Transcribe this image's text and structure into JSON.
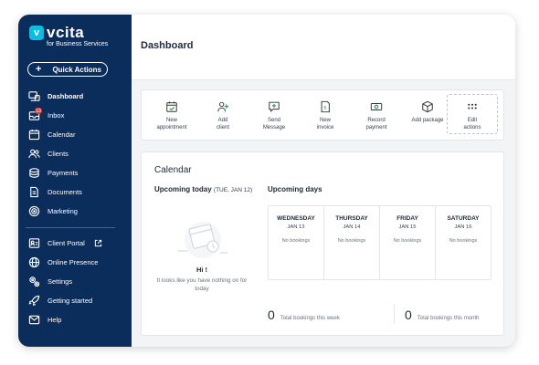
{
  "logo": {
    "mark": "v",
    "name": "vcita",
    "tagline": "for Business Services"
  },
  "quick_actions": {
    "label": "Quick Actions",
    "icon": "plus-icon"
  },
  "sidebar": {
    "items": [
      {
        "label": "Dashboard",
        "icon": "dashboard-icon",
        "active": true
      },
      {
        "label": "Inbox",
        "icon": "inbox-icon",
        "badge": "13"
      },
      {
        "label": "Calendar",
        "icon": "calendar-icon"
      },
      {
        "label": "Clients",
        "icon": "clients-icon"
      },
      {
        "label": "Payments",
        "icon": "payments-icon"
      },
      {
        "label": "Documents",
        "icon": "documents-icon"
      },
      {
        "label": "Marketing",
        "icon": "marketing-icon"
      }
    ],
    "bottom_items": [
      {
        "label": "Client Portal",
        "icon": "client-portal-icon",
        "external": true
      },
      {
        "label": "Online Presence",
        "icon": "globe-icon"
      },
      {
        "label": "Settings",
        "icon": "settings-icon"
      },
      {
        "label": "Getting started",
        "icon": "rocket-icon"
      },
      {
        "label": "Help",
        "icon": "help-icon"
      }
    ]
  },
  "header": {
    "title": "Dashboard"
  },
  "quick_action_bar": [
    {
      "label": "New\nappointment",
      "icon": "new-appointment-icon"
    },
    {
      "label": "Add\nclient",
      "icon": "add-client-icon"
    },
    {
      "label": "Send\nMessage",
      "icon": "send-message-icon"
    },
    {
      "label": "New\ninvoice",
      "icon": "new-invoice-icon"
    },
    {
      "label": "Record\npayment",
      "icon": "record-payment-icon"
    },
    {
      "label": "Add package",
      "icon": "add-package-icon"
    },
    {
      "label": "Edit\nactions",
      "icon": "edit-actions-icon"
    }
  ],
  "calendar": {
    "title": "Calendar",
    "today_label": "Upcoming today",
    "today_date": "(TUE, JAN 12)",
    "empty_title": "Hi !",
    "empty_text": "It looks like you have nothing on for today",
    "upcoming_label": "Upcoming days",
    "days": [
      {
        "name": "WEDNESDAY",
        "date": "JAN 13",
        "status": "No bookings"
      },
      {
        "name": "THURSDAY",
        "date": "JAN 14",
        "status": "No bookings"
      },
      {
        "name": "FRIDAY",
        "date": "JAN 15",
        "status": "No bookings"
      },
      {
        "name": "SATURDAY",
        "date": "JAN 16",
        "status": "No bookings"
      }
    ],
    "week_total": "0",
    "week_label": "Total bookings this week",
    "month_total": "0",
    "month_label": "Total bookings this month"
  },
  "colors": {
    "sidebar_bg": "#0b2d5c",
    "accent": "#0abde3",
    "badge": "#e03a3a",
    "action_green": "#2e9e5b"
  }
}
